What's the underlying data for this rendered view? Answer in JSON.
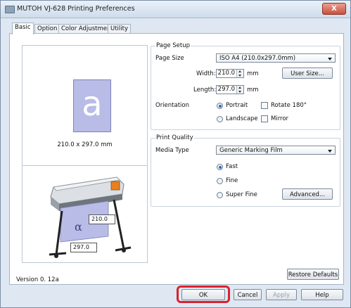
{
  "window": {
    "title": "MUTOH VJ-628 Printing Preferences",
    "close_glyph": "X"
  },
  "tabs": [
    "Basic",
    "Option",
    "Color Adjustment",
    "Utility"
  ],
  "preview": {
    "paper_letter": "a",
    "dimensions": "210.0 x 297.0 mm"
  },
  "printer_preview": {
    "paper_letter": "α",
    "width_value": "210.0",
    "length_value": "297.0"
  },
  "page_setup": {
    "title": "Page Setup",
    "page_size_label": "Page Size",
    "page_size_value": "ISO A4 (210.0x297.0mm)",
    "width_label": "Width:",
    "width_value": "210.0",
    "width_unit": "mm",
    "length_label": "Length:",
    "length_value": "297.0",
    "length_unit": "mm",
    "user_size_button": "User Size...",
    "orientation_label": "Orientation",
    "portrait": "Portrait",
    "landscape": "Landscape",
    "rotate": "Rotate 180°",
    "mirror": "Mirror"
  },
  "print_quality": {
    "title": "Print Quality",
    "media_type_label": "Media Type",
    "media_type_value": "Generic Marking Film",
    "fast": "Fast",
    "fine": "Fine",
    "super_fine": "Super Fine",
    "advanced_button": "Advanced..."
  },
  "restore_defaults": "Restore Defaults",
  "version": "Version 0. 12a",
  "buttons": {
    "ok": "OK",
    "cancel": "Cancel",
    "apply": "Apply",
    "help": "Help"
  },
  "colors": {
    "highlight": "#d8222f",
    "paper": "#b8bce6",
    "accent": "#2d63c7"
  }
}
